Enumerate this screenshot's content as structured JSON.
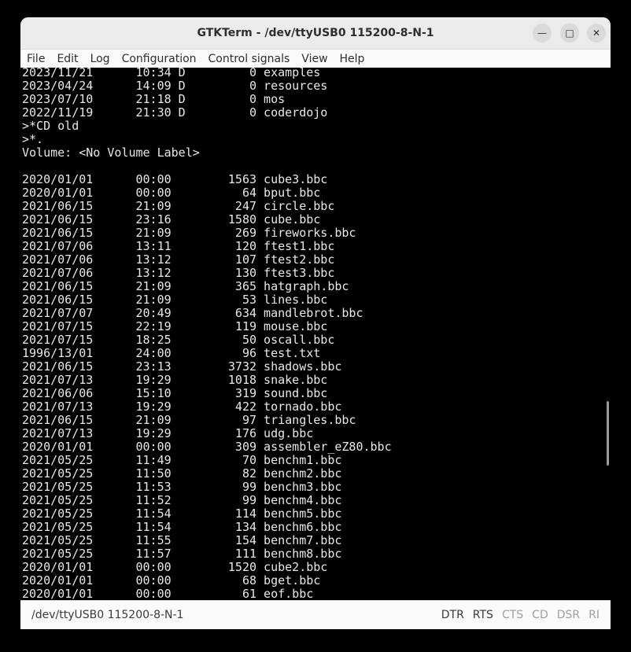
{
  "window": {
    "title": "GTKTerm - /dev/ttyUSB0  115200-8-N-1"
  },
  "menu": [
    "File",
    "Edit",
    "Log",
    "Configuration",
    "Control signals",
    "View",
    "Help"
  ],
  "terminal_lines": [
    "2023/11/21      10:34 D         0 examples",
    "2023/04/24      14:09 D         0 resources",
    "2023/07/10      21:18 D         0 mos",
    "2022/11/19      21:30 D         0 coderdojo",
    ">*CD old",
    ">*.",
    "Volume: <No Volume Label>",
    "",
    "2020/01/01      00:00        1563 cube3.bbc",
    "2020/01/01      00:00          64 bput.bbc",
    "2021/06/15      21:09         247 circle.bbc",
    "2021/06/15      23:16        1580 cube.bbc",
    "2021/06/15      21:09         269 fireworks.bbc",
    "2021/07/06      13:11         120 ftest1.bbc",
    "2021/07/06      13:12         107 ftest2.bbc",
    "2021/07/06      13:12         130 ftest3.bbc",
    "2021/06/15      21:09         365 hatgraph.bbc",
    "2021/06/15      21:09          53 lines.bbc",
    "2021/07/07      20:49         634 mandlebrot.bbc",
    "2021/07/15      22:19         119 mouse.bbc",
    "2021/07/15      18:25          50 oscall.bbc",
    "1996/13/01      24:00          96 test.txt",
    "2021/06/15      23:13        3732 shadows.bbc",
    "2021/07/13      19:29        1018 snake.bbc",
    "2021/06/06      15:10         319 sound.bbc",
    "2021/07/13      19:29         422 tornado.bbc",
    "2021/06/15      21:09          97 triangles.bbc",
    "2021/07/13      19:29         176 udg.bbc",
    "2020/01/01      00:00         309 assembler_eZ80.bbc",
    "2021/05/25      11:49          70 benchm1.bbc",
    "2021/05/25      11:50          82 benchm2.bbc",
    "2021/05/25      11:53          99 benchm3.bbc",
    "2021/05/25      11:52          99 benchm4.bbc",
    "2021/05/25      11:54         114 benchm5.bbc",
    "2021/05/25      11:54         134 benchm6.bbc",
    "2021/05/25      11:55         154 benchm7.bbc",
    "2021/05/25      11:57         111 benchm8.bbc",
    "2020/01/01      00:00        1520 cube2.bbc",
    "2020/01/01      00:00          68 bget.bbc",
    "2020/01/01      00:00          61 eof.bbc"
  ],
  "status": {
    "port": "/dev/ttyUSB0  115200-8-N-1",
    "signals": [
      {
        "label": "DTR",
        "active": true
      },
      {
        "label": "RTS",
        "active": true
      },
      {
        "label": "CTS",
        "active": false
      },
      {
        "label": "CD",
        "active": false
      },
      {
        "label": "DSR",
        "active": false
      },
      {
        "label": "RI",
        "active": false
      }
    ]
  },
  "colors": {
    "terminal_bg": "#000000",
    "terminal_fg": "#e8e8e8",
    "active_signal": "#3a3a3a",
    "inactive_signal": "#9e9e9e"
  },
  "icons": {
    "minimize": "minimize-icon",
    "maximize": "maximize-icon",
    "close": "close-icon"
  }
}
